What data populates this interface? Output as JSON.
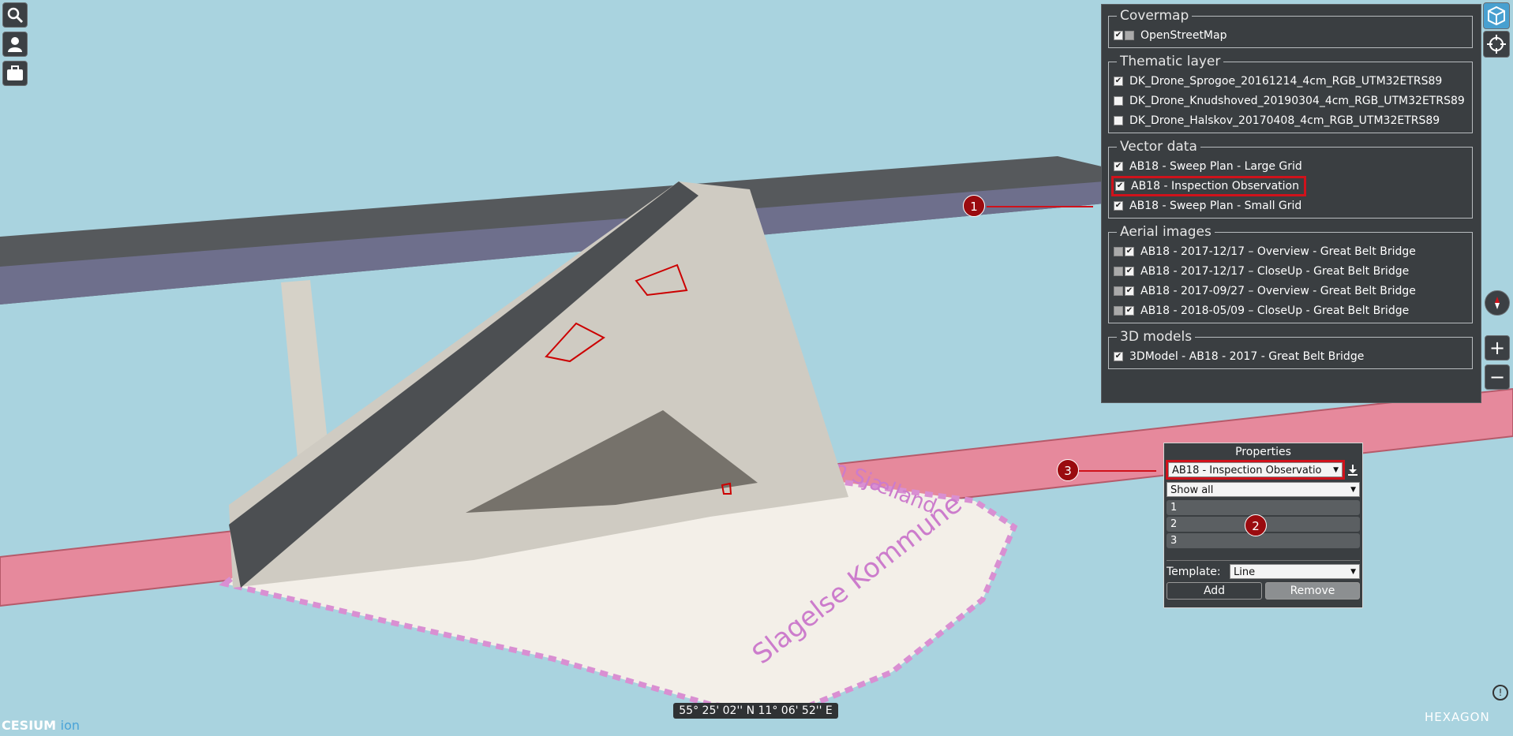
{
  "layer_panel": {
    "sections": [
      {
        "title": "Covermap",
        "items": [
          {
            "label": "OpenStreetMap",
            "checked": true
          }
        ]
      },
      {
        "title": "Thematic layer",
        "items": [
          {
            "label": "DK_Drone_Sprogoe_20161214_4cm_RGB_UTM32ETRS89",
            "checked": true
          },
          {
            "label": "DK_Drone_Knudshoved_20190304_4cm_RGB_UTM32ETRS89",
            "checked": false
          },
          {
            "label": "DK_Drone_Halskov_20170408_4cm_RGB_UTM32ETRS89",
            "checked": false
          }
        ]
      },
      {
        "title": "Vector data",
        "items": [
          {
            "label": "AB18 - Sweep Plan - Large Grid",
            "checked": true
          },
          {
            "label": "AB18 - Inspection Observation",
            "checked": true,
            "highlighted": true
          },
          {
            "label": "AB18 - Sweep Plan - Small Grid",
            "checked": true
          }
        ]
      },
      {
        "title": "Aerial images",
        "items": [
          {
            "label": "AB18 - 2017-12/17 – Overview - Great Belt Bridge",
            "checked": true
          },
          {
            "label": "AB18 - 2017-12/17 – CloseUp - Great Belt Bridge",
            "checked": true
          },
          {
            "label": "AB18 - 2017-09/27 – Overview - Great Belt Bridge",
            "checked": true
          },
          {
            "label": "AB18 - 2018-05/09 – CloseUp - Great Belt Bridge",
            "checked": true
          }
        ]
      },
      {
        "title": "3D models",
        "items": [
          {
            "label": "3DModel - AB18 - 2017 - Great Belt Bridge",
            "checked": true
          }
        ]
      }
    ]
  },
  "properties": {
    "title": "Properties",
    "layer_select": "AB18 - Inspection Observatio",
    "filter_select": "Show all",
    "items": [
      "1",
      "2",
      "3"
    ],
    "template_label": "Template:",
    "template_value": "Line",
    "add_label": "Add",
    "remove_label": "Remove"
  },
  "markers": [
    "1",
    "2",
    "3"
  ],
  "map_labels": {
    "municipality": "Slagelse Kommune",
    "region": "n Sjælland"
  },
  "coords": "55° 25' 02'' N 11° 06' 52'' E",
  "branding": {
    "cesium": "CESIUM",
    "ion": "ion",
    "hexagon": "HEXAGON"
  },
  "colors": {
    "sky": "#a9d3df",
    "panel": "#3a3e41",
    "highlight": "#d0121b",
    "marker": "#9a0b0f",
    "boundary": "#e8a3d8"
  }
}
